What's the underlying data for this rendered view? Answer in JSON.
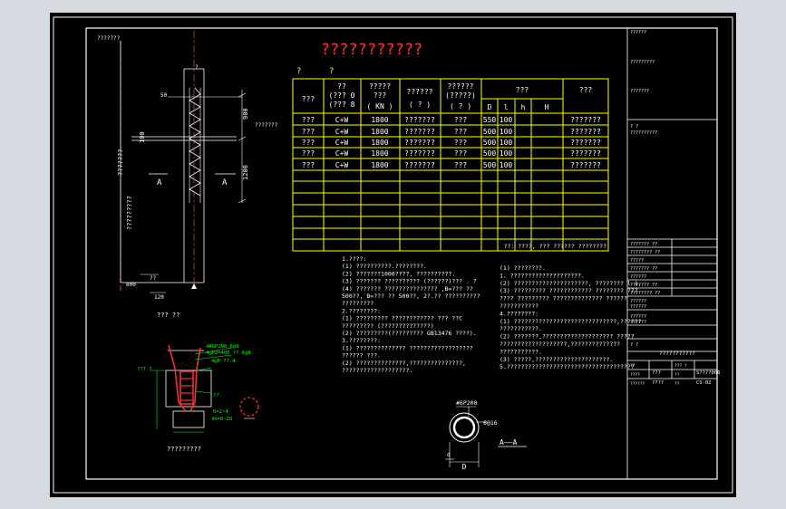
{
  "drawing": {
    "title": "???????????",
    "table_caption_left": "?",
    "table_caption_right": "?",
    "table": {
      "headers": {
        "c0": "???",
        "c1_line1": "??",
        "c1_line2": "(??? 0",
        "c1_line3": "(??? 8",
        "c2_line1": "?????",
        "c2_line2": "???",
        "c2_line3": "( KN )",
        "c3_line1": "??????",
        "c3_line2": "( ? )",
        "c4_line1": "??????",
        "c4_line2": "(?????)",
        "c4_line3": "( ? )",
        "c5": "???",
        "c5_sub": [
          "D",
          "l",
          "h",
          "H"
        ],
        "c6": "???"
      },
      "rows": [
        [
          "???",
          "C+W",
          "1800",
          "???????",
          "???",
          "550",
          "100",
          "",
          "",
          "???????"
        ],
        [
          "???",
          "C+W",
          "1800",
          "???????",
          "???",
          "500",
          "100",
          "",
          "",
          "???????"
        ],
        [
          "???",
          "C+W",
          "1800",
          "???????",
          "???",
          "500",
          "100",
          "",
          "",
          "???????"
        ],
        [
          "???",
          "C+W",
          "1800",
          "???????",
          "???",
          "500",
          "100",
          "",
          "",
          "???????"
        ],
        [
          "???",
          "C+W",
          "1800",
          "???????",
          "???",
          "500",
          "100",
          "",
          "",
          "???????"
        ]
      ],
      "footnote": "??: ????, ??? ?????? ????????"
    },
    "notes_left": [
      "1.????:",
      "(1) ??????????.????????.",
      "(2) ???????1000????, ??????????.",
      "(3) ??????? ?????????? (??????)??? . ?",
      "(4) ??????? ??????????????? ,B=???  ??",
      "    500??, B=??? ?? 500??,  2?.?? ??????????",
      "    ?????????",
      "2.????????:",
      "(1) ?????????  ???????????? ??? ??C",
      "    ?????????  (??????????????)",
      "(2) ?????????(????????? GB13476 ????).",
      "3.????????:",
      "(1) ?????????????? ??????????????????",
      "    ?????? ???.",
      "(2) ??????????????,???????????????,",
      "    ???????????????????."
    ],
    "notes_right": [
      "(1) ????????.",
      "    1. ????????????????????.",
      "(2) ?????????????????????, ????????  l  1.",
      "(3) ????????? ???????????? ???????? ???",
      "    ???? ????????? ?????????????? ??????",
      "    ???????????",
      "4.????????:",
      "(1) ?????????????????????????????,??????",
      "    ???????????.",
      "(2) ???????,???????????????????? ?????",
      "    ???????????????????,??????????????",
      "    ???????????.",
      "(3) ?????,?????????????????????.",
      "5.????????????????????????????????????"
    ],
    "pile_section": {
      "dim_900": "900",
      "dim_1200": "1200",
      "dim_100": "100",
      "dim_50": "50",
      "dim_800": "800",
      "dim_120": "120",
      "elev_top": "???????",
      "elev_side": "???????",
      "label_A1": "A",
      "label_A2": "A",
      "vert_label_1": "???????",
      "vert_label_2": "?????????",
      "small_label_1": "??",
      "small_label_2": "?",
      "caption": "??? ??"
    },
    "rebar_detail": {
      "callout_1": "4#6P2N8  6@8",
      "callout_2": "4@P2=400 ?? 6@8",
      "callout_3": "4@P ??.4",
      "callout_4": "??? ?",
      "callout_5": "6=2~4",
      "callout_6": "4h=8~28",
      "callout_7": "??",
      "caption": "?????????"
    },
    "section_aa": {
      "callout_top": "#6P200",
      "callout_mid": "6@16",
      "label_d": "D",
      "label_left": "d",
      "caption": "A——A"
    },
    "title_block": {
      "row1": "??????",
      "row2": "?????????",
      "row3": "???????",
      "row4": "?  ?",
      "row5": "??????????",
      "stamp_rows": [
        "??????? ??",
        "???????? ??",
        "?????",
        "??????? ??",
        "??????",
        "??????? ??",
        "???????? ??"
      ],
      "name_1": "??????",
      "name_2": "??????",
      "name_3": "??????",
      "name_4": "??????",
      "drawing_name_label": "? ?",
      "drawing_name": "???????????",
      "bottom_rows": [
        [
          "??",
          "??",
          "??? ?",
          "??",
          "?-??"
        ],
        [
          "????",
          "??? ?",
          "??",
          "????",
          "???"
        ],
        [
          "??????",
          "???",
          "??",
          "?????",
          "??????"
        ]
      ],
      "code_1": "???",
      "code_2": "????",
      "scale": "S????000",
      "number": "CS-02"
    }
  }
}
